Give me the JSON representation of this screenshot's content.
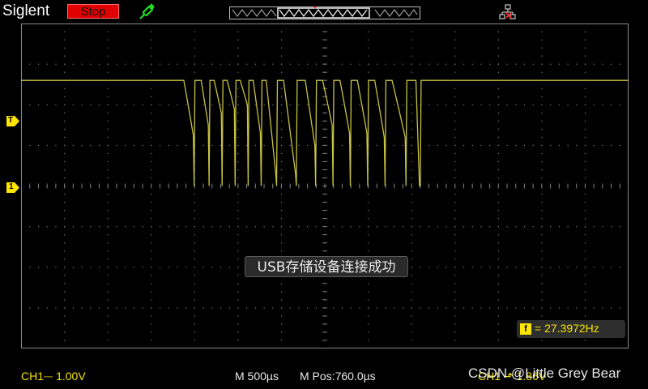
{
  "header": {
    "brand": "Siglent",
    "run_state_label": "Stop",
    "trigger_point_marker": "T"
  },
  "colors": {
    "trace": "#c8c241",
    "grid": "#7a7a7a",
    "run_state": "#e00000",
    "ch1": "#f2e400"
  },
  "icons": {
    "probe": "probe-icon",
    "network": "network-icon"
  },
  "markers": {
    "trigger_level": "T",
    "ch1_ground": "1"
  },
  "message": {
    "text": "USB存储设备连接成功"
  },
  "measurement": {
    "icon_label": "f",
    "frequency_text": "= 27.3972Hz"
  },
  "footer": {
    "ch1": "CH1⎓ 1.00V",
    "timebase": "M 500µs",
    "mpos": "M Pos:760.0µs",
    "trigger": "CH1 ⬏ 1.86V",
    "watermark": "CSDN @Little Grey Bear"
  },
  "waveform": {
    "high_level_div": 2.6,
    "low_level_div": 0.0,
    "edge_times_div": [
      3.75,
      4.15,
      4.45,
      4.75,
      5.05,
      5.35,
      5.65,
      6.05,
      6.55,
      6.95,
      7.35,
      7.75,
      8.15,
      8.55,
      9.1
    ],
    "fall_end_levels_div": [
      1.25,
      1.5,
      1.8,
      1.9,
      2.0,
      1.3,
      0.3,
      0.3,
      1.0,
      1.5,
      1.3,
      1.3,
      1.2,
      1.2,
      0.0
    ]
  }
}
